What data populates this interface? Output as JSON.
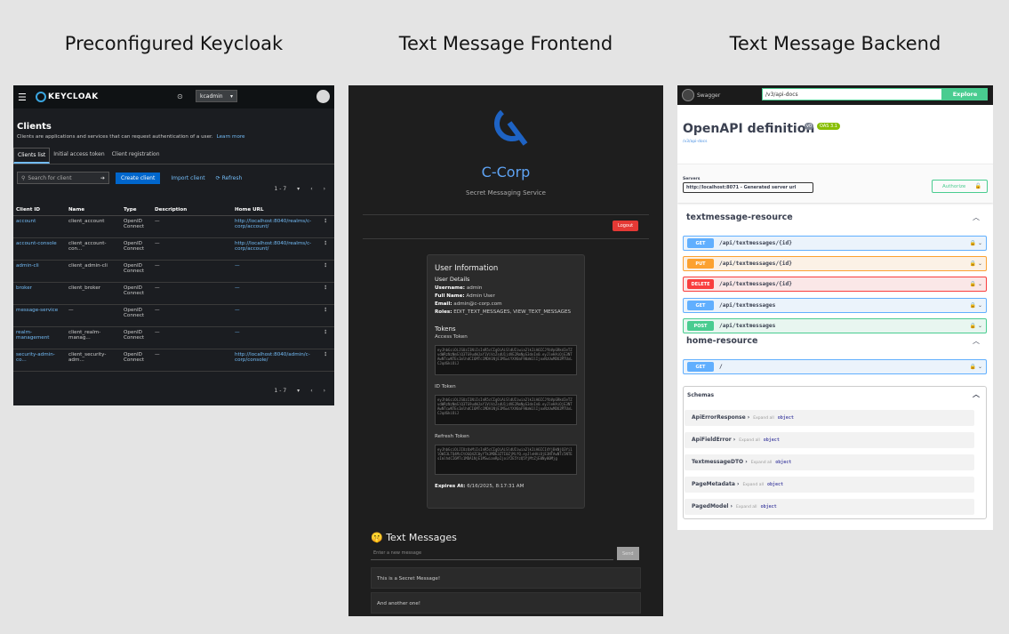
{
  "titles": {
    "keycloak": "Preconfigured Keycloak",
    "frontend": "Text Message Frontend",
    "backend": "Text Message Backend"
  },
  "keycloak": {
    "brand": "KEYCLOAK",
    "realm": "kcadmin",
    "page_title": "Clients",
    "description": "Clients are applications and services that can request authentication of a user.",
    "learn_more": "Learn more",
    "tabs": [
      "Clients list",
      "Initial access token",
      "Client registration"
    ],
    "search_placeholder": "Search for client",
    "create_button": "Create client",
    "import_button": "Import client",
    "refresh_button": "Refresh",
    "pager": "1 - 7",
    "columns": [
      "Client ID",
      "Name",
      "Type",
      "Description",
      "Home URL"
    ],
    "rows": [
      {
        "id": "account",
        "name": "client_account",
        "type": "OpenID Connect",
        "desc": "—",
        "home": "http://localhost:8040/realms/c-corp/account/"
      },
      {
        "id": "account-console",
        "name": "client_account-con...",
        "type": "OpenID Connect",
        "desc": "—",
        "home": "http://localhost:8040/realms/c-corp/account/"
      },
      {
        "id": "admin-cli",
        "name": "client_admin-cli",
        "type": "OpenID Connect",
        "desc": "—",
        "home": "—"
      },
      {
        "id": "broker",
        "name": "client_broker",
        "type": "OpenID Connect",
        "desc": "—",
        "home": "—"
      },
      {
        "id": "message-service",
        "name": "—",
        "type": "OpenID Connect",
        "desc": "—",
        "home": "—"
      },
      {
        "id": "realm-management",
        "name": "client_realm-manag...",
        "type": "OpenID Connect",
        "desc": "—",
        "home": "—"
      },
      {
        "id": "security-admin-co...",
        "name": "client_security-adm...",
        "type": "OpenID Connect",
        "desc": "—",
        "home": "http://localhost:8040/admin/c-corp/console/"
      }
    ],
    "footer_pager": "1 - 7"
  },
  "frontend": {
    "brand": "C-Corp",
    "subtitle": "Secret Messaging Service",
    "logout": "Logout",
    "card": {
      "title": "User Information",
      "details_title": "User Details",
      "username_label": "Username:",
      "username": "admin",
      "fullname_label": "Full Name:",
      "fullname": "Admin User",
      "email_label": "Email:",
      "email": "admin@c-corp.com",
      "roles_label": "Roles:",
      "roles": "EDIT_TEXT_MESSAGES, VIEW_TEXT_MESSAGES",
      "tokens_title": "Tokens",
      "access_label": "Access Token",
      "id_label": "ID Token",
      "refresh_label": "Refresh Token",
      "expires_label": "Expires At:",
      "expires": "6/16/2025, 8:17:31 AM"
    },
    "messages_title": "🤫 Text Messages",
    "input_placeholder": "Enter a new message",
    "send": "Send",
    "messages": [
      "This is a Secret Message!",
      "And another one!"
    ]
  },
  "backend": {
    "swagger": "Swagger",
    "url": "/v3/api-docs",
    "explore": "Explore",
    "title": "OpenAPI definition",
    "version": "v0",
    "oas": "OAS 3.1",
    "docs_link": "/v3/api-docs",
    "servers_label": "Servers",
    "server": "http://localhost:8071 - Generated server url",
    "authorize": "Authorize",
    "sections": [
      "textmessage-resource",
      "home-resource"
    ],
    "ops": [
      {
        "method": "GET",
        "path": "/api/textmessages/{id}"
      },
      {
        "method": "PUT",
        "path": "/api/textmessages/{id}"
      },
      {
        "method": "DELETE",
        "path": "/api/textmessages/{id}"
      },
      {
        "method": "GET",
        "path": "/api/textmessages"
      },
      {
        "method": "POST",
        "path": "/api/textmessages"
      },
      {
        "method": "GET",
        "path": "/"
      }
    ],
    "schemas_title": "Schemas",
    "expand_all": "Expand all",
    "object": "object",
    "models": [
      "ApiErrorResponse",
      "ApiFieldError",
      "TextmessageDTO",
      "PageMetadata",
      "PagedModel"
    ],
    "colors": {
      "GET": "#61affe",
      "PUT": "#fca130",
      "DELETE": "#f93e3e",
      "POST": "#49cc90"
    }
  }
}
